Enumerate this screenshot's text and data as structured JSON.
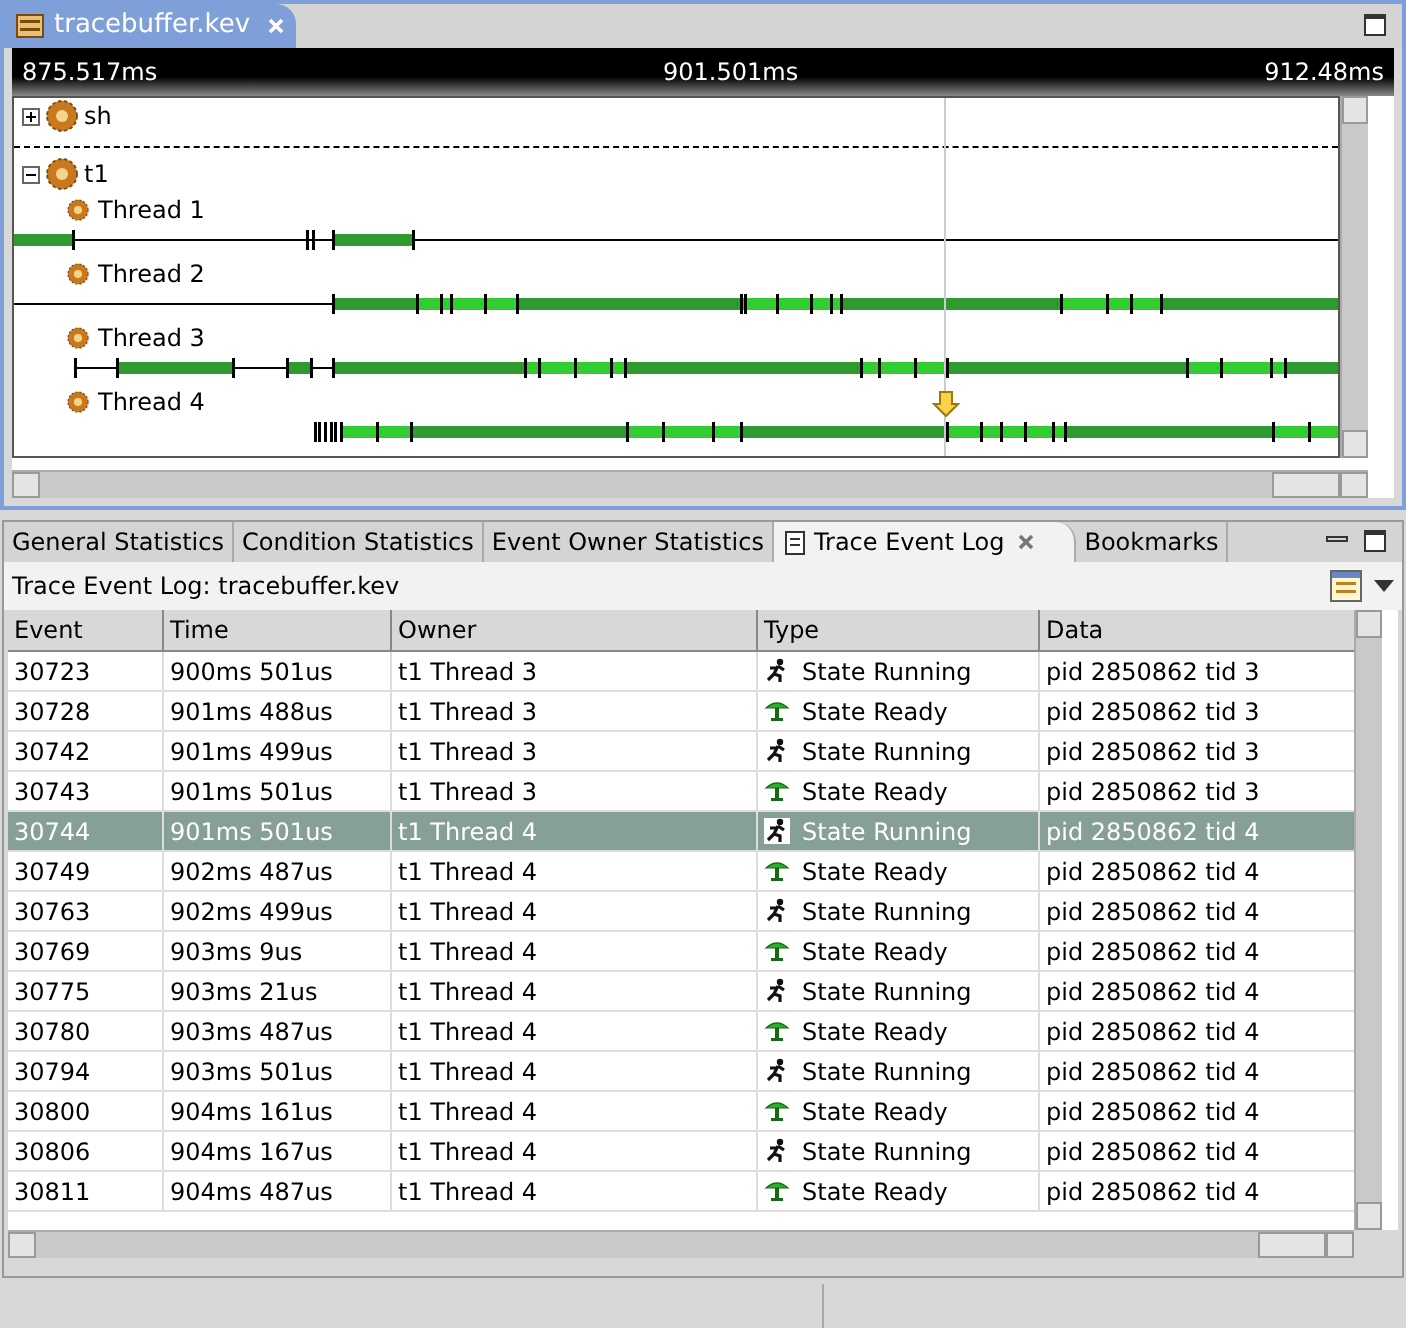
{
  "editor": {
    "tab": {
      "title": "tracebuffer.kev",
      "selected": true
    },
    "ruler": {
      "start": "875.517ms",
      "middle": "901.501ms",
      "end": "912.48ms"
    },
    "processes": [
      {
        "name": "sh",
        "expanded": false
      },
      {
        "name": "t1",
        "expanded": true,
        "threads": [
          "Thread 1",
          "Thread 2",
          "Thread 3",
          "Thread 4"
        ]
      }
    ]
  },
  "views": {
    "tabs": [
      {
        "label": "General Statistics",
        "selected": false
      },
      {
        "label": "Condition Statistics",
        "selected": false
      },
      {
        "label": "Event Owner Statistics",
        "selected": false
      },
      {
        "label": "Trace Event Log",
        "selected": true
      },
      {
        "label": "Bookmarks",
        "selected": false
      }
    ],
    "title": "Trace Event Log: tracebuffer.kev",
    "table": {
      "columns": [
        "Event",
        "Time",
        "Owner",
        "Type",
        "Data"
      ],
      "rows": [
        {
          "event": "30723",
          "time": "900ms 501us",
          "owner": "t1 Thread 3",
          "kind": "running",
          "type": "State Running",
          "data": "pid 2850862 tid 3",
          "selected": false
        },
        {
          "event": "30728",
          "time": "901ms 488us",
          "owner": "t1 Thread 3",
          "kind": "ready",
          "type": "State Ready",
          "data": "pid 2850862 tid 3",
          "selected": false
        },
        {
          "event": "30742",
          "time": "901ms 499us",
          "owner": "t1 Thread 3",
          "kind": "running",
          "type": "State Running",
          "data": "pid 2850862 tid 3",
          "selected": false
        },
        {
          "event": "30743",
          "time": "901ms 501us",
          "owner": "t1 Thread 3",
          "kind": "ready",
          "type": "State Ready",
          "data": "pid 2850862 tid 3",
          "selected": false
        },
        {
          "event": "30744",
          "time": "901ms 501us",
          "owner": "t1 Thread 4",
          "kind": "running",
          "type": "State Running",
          "data": "pid 2850862 tid 4",
          "selected": true
        },
        {
          "event": "30749",
          "time": "902ms 487us",
          "owner": "t1 Thread 4",
          "kind": "ready",
          "type": "State Ready",
          "data": "pid 2850862 tid 4",
          "selected": false
        },
        {
          "event": "30763",
          "time": "902ms 499us",
          "owner": "t1 Thread 4",
          "kind": "running",
          "type": "State Running",
          "data": "pid 2850862 tid 4",
          "selected": false
        },
        {
          "event": "30769",
          "time": "903ms 9us",
          "owner": "t1 Thread 4",
          "kind": "ready",
          "type": "State Ready",
          "data": "pid 2850862 tid 4",
          "selected": false
        },
        {
          "event": "30775",
          "time": "903ms 21us",
          "owner": "t1 Thread 4",
          "kind": "running",
          "type": "State Running",
          "data": "pid 2850862 tid 4",
          "selected": false
        },
        {
          "event": "30780",
          "time": "903ms 487us",
          "owner": "t1 Thread 4",
          "kind": "ready",
          "type": "State Ready",
          "data": "pid 2850862 tid 4",
          "selected": false
        },
        {
          "event": "30794",
          "time": "903ms 501us",
          "owner": "t1 Thread 4",
          "kind": "running",
          "type": "State Running",
          "data": "pid 2850862 tid 4",
          "selected": false
        },
        {
          "event": "30800",
          "time": "904ms 161us",
          "owner": "t1 Thread 4",
          "kind": "ready",
          "type": "State Ready",
          "data": "pid 2850862 tid 4",
          "selected": false
        },
        {
          "event": "30806",
          "time": "904ms 167us",
          "owner": "t1 Thread 4",
          "kind": "running",
          "type": "State Running",
          "data": "pid 2850862 tid 4",
          "selected": false
        },
        {
          "event": "30811",
          "time": "904ms 487us",
          "owner": "t1 Thread 4",
          "kind": "ready",
          "type": "State Ready",
          "data": "pid 2850862 tid 4",
          "selected": false
        }
      ]
    }
  }
}
